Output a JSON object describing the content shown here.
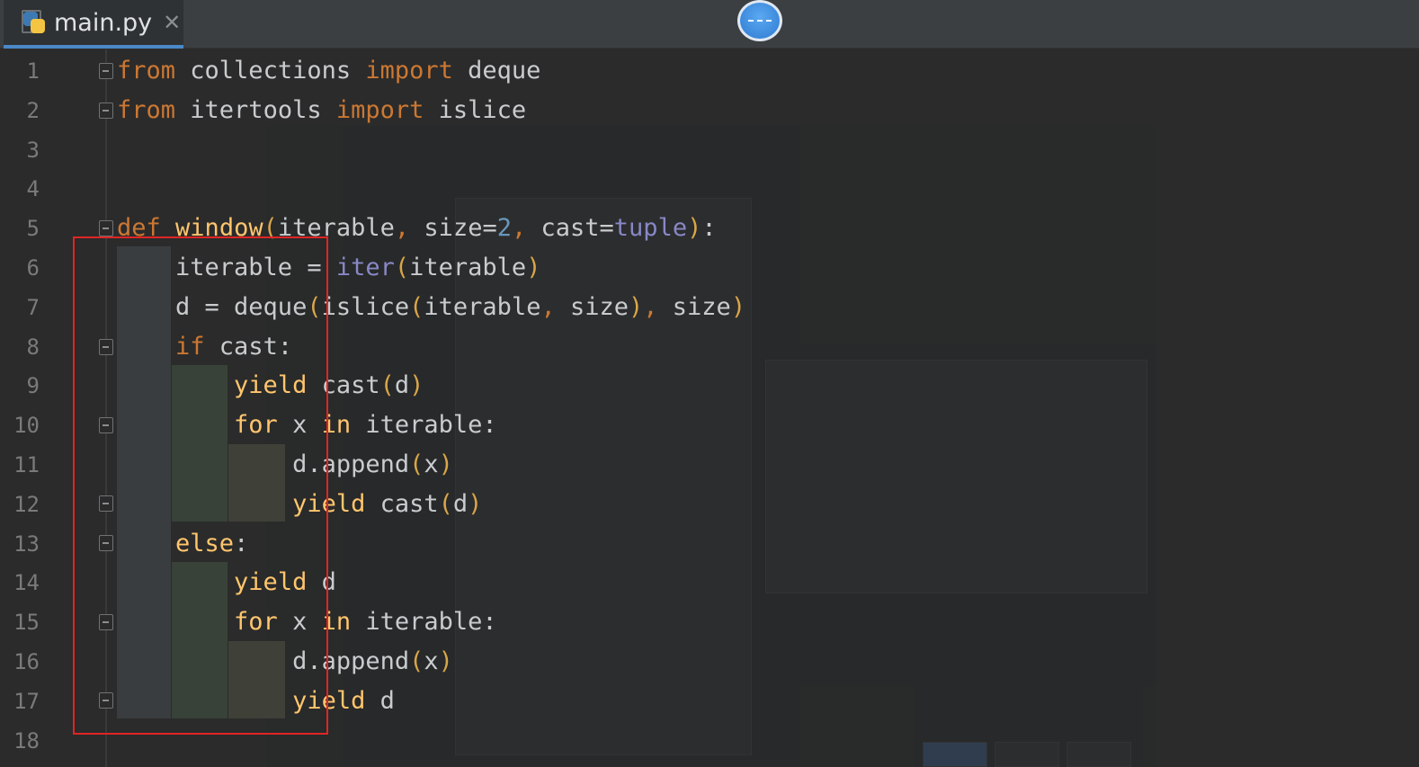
{
  "tabs": {
    "active": {
      "label": "main.py",
      "close": "✕"
    }
  },
  "editor": {
    "line_numbers": [
      "1",
      "2",
      "3",
      "4",
      "5",
      "6",
      "7",
      "8",
      "9",
      "10",
      "11",
      "12",
      "13",
      "14",
      "15",
      "16",
      "17",
      "18"
    ],
    "lines": [
      [
        [
          "kw",
          "from"
        ],
        [
          "p",
          " collections "
        ],
        [
          "kw",
          "import"
        ],
        [
          "p",
          " deque"
        ]
      ],
      [
        [
          "kw",
          "from"
        ],
        [
          "p",
          " itertools "
        ],
        [
          "kw",
          "import"
        ],
        [
          "p",
          " islice"
        ]
      ],
      [],
      [],
      [
        [
          "kw",
          "def"
        ],
        [
          "p",
          " "
        ],
        [
          "fn",
          "window"
        ],
        [
          "pr",
          "("
        ],
        [
          "p",
          "iterable"
        ],
        [
          "pn",
          ","
        ],
        [
          "p",
          " size="
        ],
        [
          "num",
          "2"
        ],
        [
          "pn",
          ","
        ],
        [
          "p",
          " cast="
        ],
        [
          "bi",
          "tuple"
        ],
        [
          "pr",
          ")"
        ],
        [
          "p",
          ":"
        ]
      ],
      [
        [
          "p",
          "    iterable = "
        ],
        [
          "bi",
          "iter"
        ],
        [
          "pr",
          "("
        ],
        [
          "p",
          "iterable"
        ],
        [
          "pr",
          ")"
        ]
      ],
      [
        [
          "p",
          "    d = deque"
        ],
        [
          "pr",
          "("
        ],
        [
          "p",
          "islice"
        ],
        [
          "pr",
          "("
        ],
        [
          "p",
          "iterable"
        ],
        [
          "pn",
          ","
        ],
        [
          "p",
          " size"
        ],
        [
          "pr",
          ")"
        ],
        [
          "pn",
          ","
        ],
        [
          "p",
          " size"
        ],
        [
          "pr",
          ")"
        ]
      ],
      [
        [
          "p",
          "    "
        ],
        [
          "kw",
          "if"
        ],
        [
          "p",
          " cast:"
        ]
      ],
      [
        [
          "p",
          "        "
        ],
        [
          "fn",
          "yield"
        ],
        [
          "p",
          " cast"
        ],
        [
          "pr",
          "("
        ],
        [
          "p",
          "d"
        ],
        [
          "pr",
          ")"
        ]
      ],
      [
        [
          "p",
          "        "
        ],
        [
          "fn",
          "for"
        ],
        [
          "p",
          " x "
        ],
        [
          "fn",
          "in"
        ],
        [
          "p",
          " iterable:"
        ]
      ],
      [
        [
          "p",
          "            d.append"
        ],
        [
          "pr",
          "("
        ],
        [
          "p",
          "x"
        ],
        [
          "pr",
          ")"
        ]
      ],
      [
        [
          "p",
          "            "
        ],
        [
          "fn",
          "yield"
        ],
        [
          "p",
          " cast"
        ],
        [
          "pr",
          "("
        ],
        [
          "p",
          "d"
        ],
        [
          "pr",
          ")"
        ]
      ],
      [
        [
          "p",
          "    "
        ],
        [
          "fn",
          "else"
        ],
        [
          "p",
          ":"
        ]
      ],
      [
        [
          "p",
          "        "
        ],
        [
          "fn",
          "yield"
        ],
        [
          "p",
          " d"
        ]
      ],
      [
        [
          "p",
          "        "
        ],
        [
          "fn",
          "for"
        ],
        [
          "p",
          " x "
        ],
        [
          "fn",
          "in"
        ],
        [
          "p",
          " iterable:"
        ]
      ],
      [
        [
          "p",
          "            d.append"
        ],
        [
          "pr",
          "("
        ],
        [
          "p",
          "x"
        ],
        [
          "pr",
          ")"
        ]
      ],
      [
        [
          "p",
          "            "
        ],
        [
          "fn",
          "yield"
        ],
        [
          "p",
          " d"
        ]
      ],
      []
    ]
  },
  "colors": {
    "keyword": "#cc7832",
    "function": "#ffc66d",
    "builtin": "#8888c6",
    "number": "#6897bb",
    "annotation": "#e02525"
  }
}
